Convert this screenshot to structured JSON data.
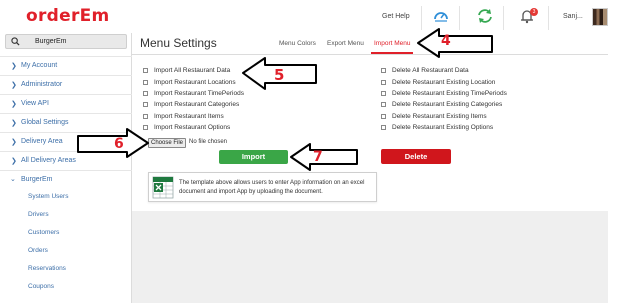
{
  "header": {
    "logo": "orderEm",
    "help": "Get Help",
    "notification_count": "3",
    "user_name": "Sanj..."
  },
  "sidebar": {
    "search_value": "BurgerEm",
    "items": [
      {
        "label": "My Account"
      },
      {
        "label": "Administrator"
      },
      {
        "label": "View API"
      },
      {
        "label": "Global Settings"
      },
      {
        "label": "Delivery Area"
      },
      {
        "label": "All Delivery Areas"
      },
      {
        "label": "BurgerEm"
      }
    ],
    "sub_items": [
      {
        "label": "System Users"
      },
      {
        "label": "Drivers"
      },
      {
        "label": "Customers"
      },
      {
        "label": "Orders"
      },
      {
        "label": "Reservations"
      },
      {
        "label": "Coupons"
      }
    ]
  },
  "main": {
    "title": "Menu Settings",
    "tabs": [
      {
        "label": "Menu Colors"
      },
      {
        "label": "Export Menu"
      },
      {
        "label": "Import Menu"
      }
    ],
    "import_options": [
      {
        "label": "Import All Restaurant Data"
      },
      {
        "label": "Import Restaurant Locations"
      },
      {
        "label": "Import Restaurant TimePeriods"
      },
      {
        "label": "Import Restaurant Categories"
      },
      {
        "label": "Import Restaurant Items"
      },
      {
        "label": "Import Restaurant Options"
      }
    ],
    "delete_options": [
      {
        "label": "Delete All Restaurant Data"
      },
      {
        "label": "Delete Restaurant Existing Location"
      },
      {
        "label": "Delete Restaurant Existing TimePeriods"
      },
      {
        "label": "Delete Restaurant Existing Categories"
      },
      {
        "label": "Delete Restaurant Existing Items"
      },
      {
        "label": "Delete Restaurant Existing Options"
      }
    ],
    "file_button": "Choose File",
    "file_status": "No file chosen",
    "import_button": "Import",
    "delete_button": "Delete",
    "info_text": "The template above allows users to enter App information on an excel document and import App by uploading the document."
  },
  "annotations": {
    "n4": "4",
    "n5": "5",
    "n6": "6",
    "n7": "7"
  },
  "colors": {
    "brand": "#e0202a",
    "import_green": "#3aa647",
    "delete_red": "#d0161c",
    "link_blue": "#3d6fa8"
  }
}
